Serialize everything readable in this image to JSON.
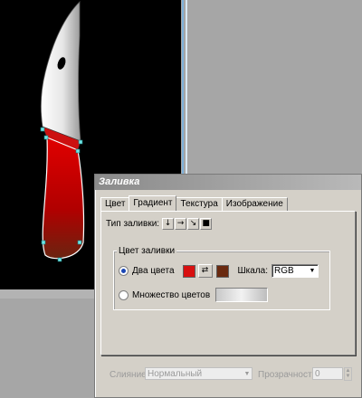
{
  "dialog": {
    "title": "Заливка",
    "tabs": [
      "Цвет",
      "Градиент",
      "Текстура",
      "Изображение"
    ],
    "active_tab": "Градиент",
    "fill_type_label": "Тип заливки:",
    "fill_type_buttons": [
      {
        "icon": "arrow-down-icon",
        "glyph": "↓"
      },
      {
        "icon": "arrow-right-icon",
        "glyph": "→"
      },
      {
        "icon": "arrow-diagonal-icon",
        "glyph": "↘"
      },
      {
        "icon": "square-icon",
        "glyph": "■"
      }
    ],
    "fill_color_group": "Цвет заливки",
    "two_colors_label": "Два цвета",
    "two_colors_selected": true,
    "color1": "#d81010",
    "color2": "#6a2a10",
    "swap_icon": "swap-icon",
    "scale_label": "Шкала:",
    "scale_value": "RGB",
    "multi_colors_label": "Множество цветов",
    "blend_label": "Слияние:",
    "blend_value": "Нормальный",
    "transparency_label": "Прозрачность:",
    "transparency_value": "0"
  },
  "colors": {
    "canvas_bg": "#000000",
    "app_bg": "#a6a6a6",
    "dialog_bg": "#d4d0c8",
    "knife_handle": "#c00000",
    "knife_blade": "#e8e8e8"
  }
}
